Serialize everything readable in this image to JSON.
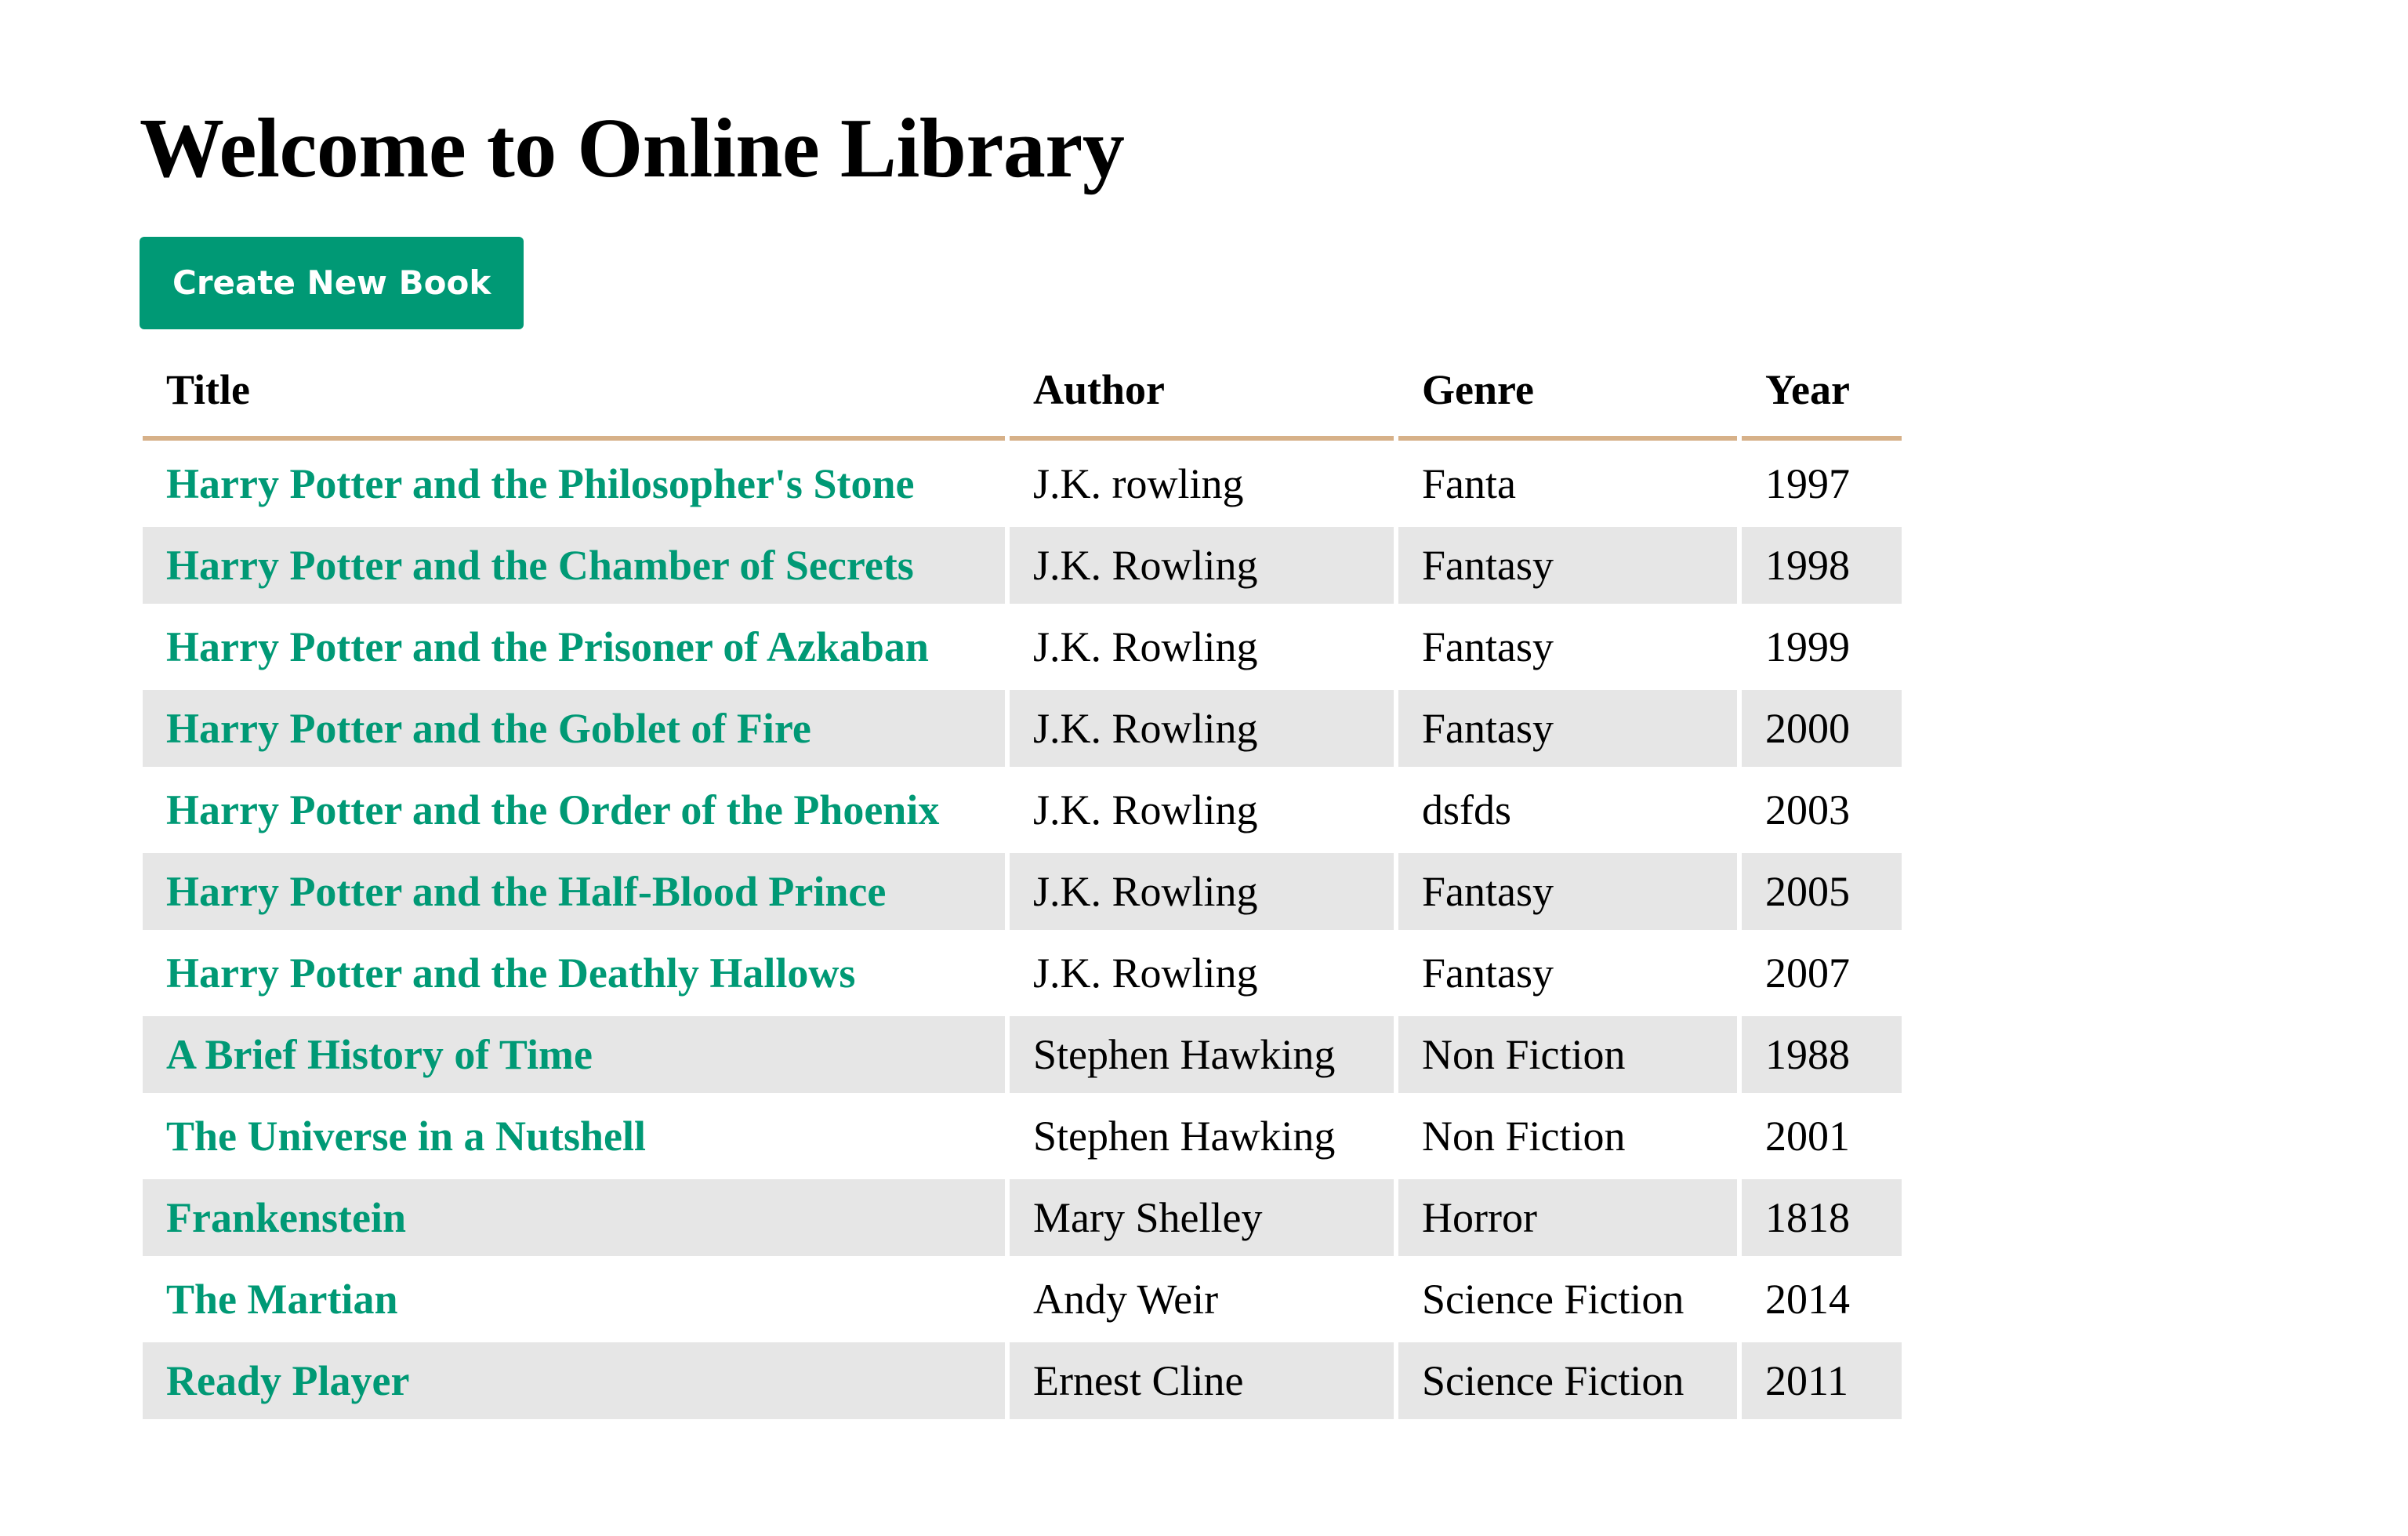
{
  "page": {
    "heading": "Welcome to Online Library",
    "create_button_label": "Create New Book"
  },
  "table": {
    "headers": {
      "title": "Title",
      "author": "Author",
      "genre": "Genre",
      "year": "Year"
    },
    "rows": [
      {
        "title": "Harry Potter and the Philosopher's Stone",
        "author": "J.K. rowling",
        "genre": "Fanta",
        "year": "1997"
      },
      {
        "title": "Harry Potter and the Chamber of Secrets",
        "author": "J.K. Rowling",
        "genre": "Fantasy",
        "year": "1998"
      },
      {
        "title": "Harry Potter and the Prisoner of Azkaban",
        "author": "J.K. Rowling",
        "genre": "Fantasy",
        "year": "1999"
      },
      {
        "title": "Harry Potter and the Goblet of Fire",
        "author": "J.K. Rowling",
        "genre": "Fantasy",
        "year": "2000"
      },
      {
        "title": "Harry Potter and the Order of the Phoenix",
        "author": "J.K. Rowling",
        "genre": "dsfds",
        "year": "2003"
      },
      {
        "title": "Harry Potter and the Half-Blood Prince",
        "author": "J.K. Rowling",
        "genre": "Fantasy",
        "year": "2005"
      },
      {
        "title": "Harry Potter and the Deathly Hallows",
        "author": "J.K. Rowling",
        "genre": "Fantasy",
        "year": "2007"
      },
      {
        "title": "A Brief History of Time",
        "author": "Stephen Hawking",
        "genre": "Non Fiction",
        "year": "1988"
      },
      {
        "title": "The Universe in a Nutshell",
        "author": "Stephen Hawking",
        "genre": "Non Fiction",
        "year": "2001"
      },
      {
        "title": "Frankenstein",
        "author": "Mary Shelley",
        "genre": "Horror",
        "year": "1818"
      },
      {
        "title": "The Martian",
        "author": "Andy Weir",
        "genre": "Science Fiction",
        "year": "2014"
      },
      {
        "title": "Ready Player",
        "author": "Ernest Cline",
        "genre": "Science Fiction",
        "year": "2011"
      }
    ]
  },
  "colors": {
    "accent": "#009975",
    "header_border": "#d7b189",
    "stripe": "#e6e6e6"
  }
}
